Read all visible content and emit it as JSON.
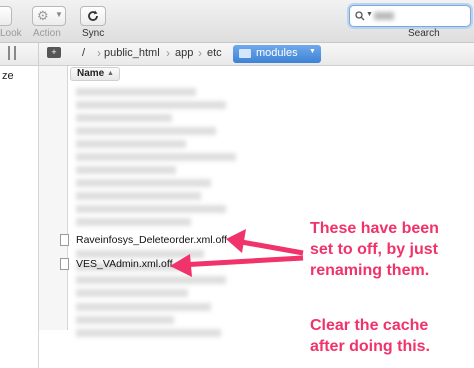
{
  "toolbar": {
    "look_label": "Look",
    "action_label": "Action",
    "sync_label": "Sync",
    "search_label": "Search",
    "search_value": "Q•.."
  },
  "pathbar": {
    "crumbs": [
      "/",
      "public_html",
      "app",
      "etc"
    ],
    "active": "modules"
  },
  "sidebar": {
    "label": "ze"
  },
  "list": {
    "column_header": "Name",
    "files": [
      "Raveinfosys_Deleteorder.xml.off",
      "VES_VAdmin.xml.off"
    ]
  },
  "annotation": {
    "line1": "These have been",
    "line2": "set to off, by just",
    "line3": "renaming them.",
    "line4": "Clear the cache",
    "line5": "after doing this."
  },
  "colors": {
    "annotation": "#f0336a",
    "accent": "#3d82d6"
  }
}
